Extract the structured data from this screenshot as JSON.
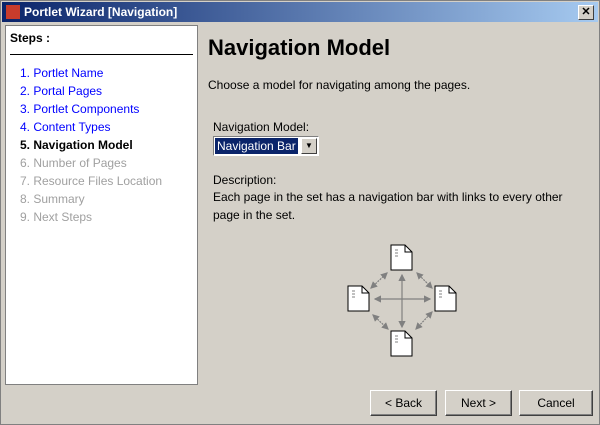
{
  "window": {
    "title": "Portlet Wizard [Navigation]",
    "close": "✕"
  },
  "steps": {
    "heading": "Steps :",
    "items": [
      {
        "label": "1. Portlet Name",
        "state": "done"
      },
      {
        "label": "2. Portal Pages",
        "state": "done"
      },
      {
        "label": "3. Portlet Components",
        "state": "done"
      },
      {
        "label": "4. Content Types",
        "state": "done"
      },
      {
        "label": "5. Navigation Model",
        "state": "current"
      },
      {
        "label": "6. Number of Pages",
        "state": "pending"
      },
      {
        "label": "7. Resource Files Location",
        "state": "pending"
      },
      {
        "label": "8. Summary",
        "state": "pending"
      },
      {
        "label": "9. Next Steps",
        "state": "pending"
      }
    ]
  },
  "main": {
    "title": "Navigation Model",
    "intro": "Choose a model for navigating among the pages.",
    "field_label": "Navigation Model:",
    "field_value": "Navigation Bar",
    "desc_label": "Description:",
    "desc_line1": "Each page in the set has a navigation bar with links to every other",
    "desc_line2": "page in the set."
  },
  "buttons": {
    "back": "< Back",
    "next": "Next >",
    "cancel": "Cancel"
  }
}
